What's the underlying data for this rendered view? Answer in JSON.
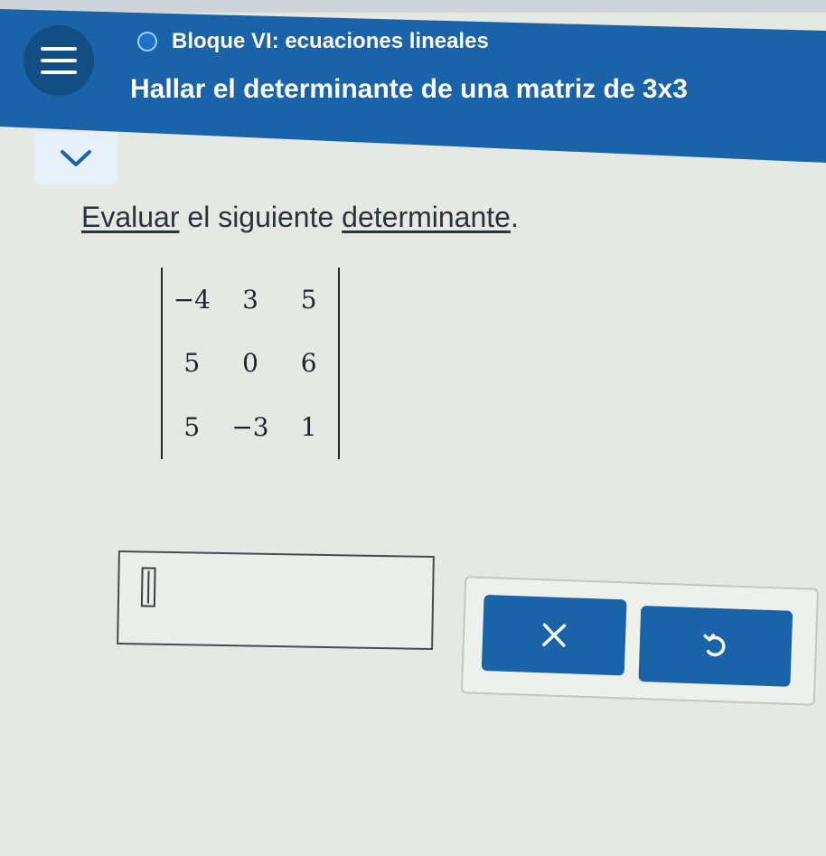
{
  "header": {
    "topic": "Bloque VI: ecuaciones lineales",
    "title": "Hallar el determinante de una matriz de 3x3"
  },
  "instruction": {
    "word1": "Evaluar",
    "middle": " el siguiente ",
    "word2": "determinante",
    "end": "."
  },
  "matrix": {
    "rows": [
      [
        "−4",
        "3",
        "5"
      ],
      [
        "5",
        "0",
        "6"
      ],
      [
        "5",
        "−3",
        "1"
      ]
    ]
  },
  "answer": {
    "value": ""
  },
  "icons": {
    "menu": "hamburger-icon",
    "collapse": "chevron-down-icon",
    "clear": "x-icon",
    "undo": "undo-icon"
  },
  "colors": {
    "header": "#1a63a8",
    "button": "#1a63a8",
    "background": "#e6e8e3"
  }
}
